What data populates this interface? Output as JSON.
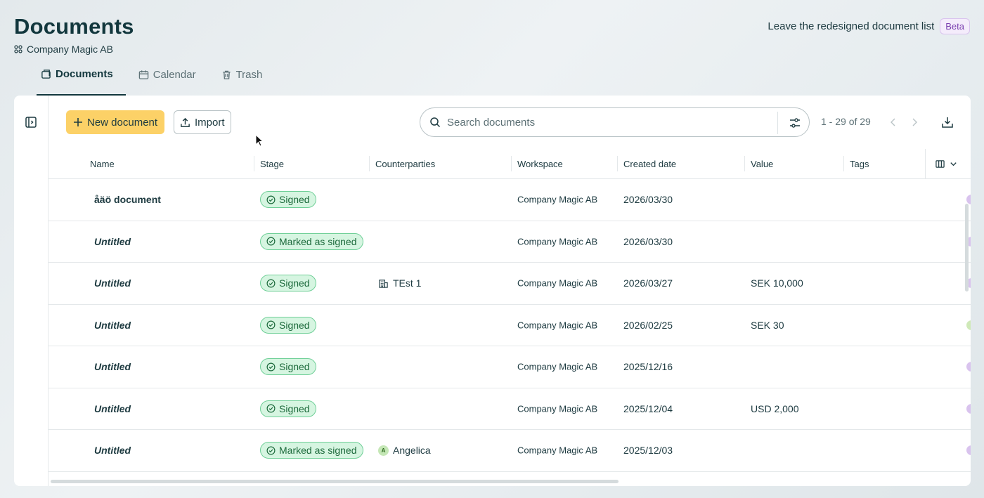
{
  "header": {
    "title": "Documents",
    "workspace": "Company Magic AB",
    "leave_text": "Leave the redesigned document list",
    "beta": "Beta"
  },
  "tabs": [
    {
      "label": "Documents",
      "icon": "documents-icon",
      "active": true
    },
    {
      "label": "Calendar",
      "icon": "calendar-icon",
      "active": false
    },
    {
      "label": "Trash",
      "icon": "trash-icon",
      "active": false
    }
  ],
  "toolbar": {
    "new_label": "New document",
    "import_label": "Import",
    "search_placeholder": "Search documents",
    "pager": "1 - 29 of 29"
  },
  "columns": {
    "name": "Name",
    "stage": "Stage",
    "counterparties": "Counterparties",
    "workspace": "Workspace",
    "created": "Created date",
    "value": "Value",
    "tags": "Tags"
  },
  "rows": [
    {
      "name": "åäö document",
      "italic": false,
      "stage": "Signed",
      "counterparty": "",
      "cp_type": "",
      "workspace": "Company Magic AB",
      "date": "2026/03/30",
      "value": "",
      "edge": "#d9c3ee"
    },
    {
      "name": "Untitled",
      "italic": true,
      "stage": "Marked as signed",
      "counterparty": "",
      "cp_type": "",
      "workspace": "Company Magic AB",
      "date": "2026/03/30",
      "value": "",
      "edge": "#d9c3ee"
    },
    {
      "name": "Untitled",
      "italic": true,
      "stage": "Signed",
      "counterparty": "TEst 1",
      "cp_type": "company",
      "workspace": "Company Magic AB",
      "date": "2026/03/27",
      "value": "SEK 10,000",
      "edge": "#d9c3ee"
    },
    {
      "name": "Untitled",
      "italic": true,
      "stage": "Signed",
      "counterparty": "",
      "cp_type": "",
      "workspace": "Company Magic AB",
      "date": "2026/02/25",
      "value": "SEK 30",
      "edge": "#cfe9b8"
    },
    {
      "name": "Untitled",
      "italic": true,
      "stage": "Signed",
      "counterparty": "",
      "cp_type": "",
      "workspace": "Company Magic AB",
      "date": "2025/12/16",
      "value": "",
      "edge": "#d9c3ee"
    },
    {
      "name": "Untitled",
      "italic": true,
      "stage": "Signed",
      "counterparty": "",
      "cp_type": "",
      "workspace": "Company Magic AB",
      "date": "2025/12/04",
      "value": "USD 2,000",
      "edge": "#d9c3ee"
    },
    {
      "name": "Untitled",
      "italic": true,
      "stage": "Marked as signed",
      "counterparty": "Angelica",
      "cp_type": "person",
      "cp_initial": "A",
      "workspace": "Company Magic AB",
      "date": "2025/12/03",
      "value": "",
      "edge": "#d9c3ee"
    }
  ]
}
